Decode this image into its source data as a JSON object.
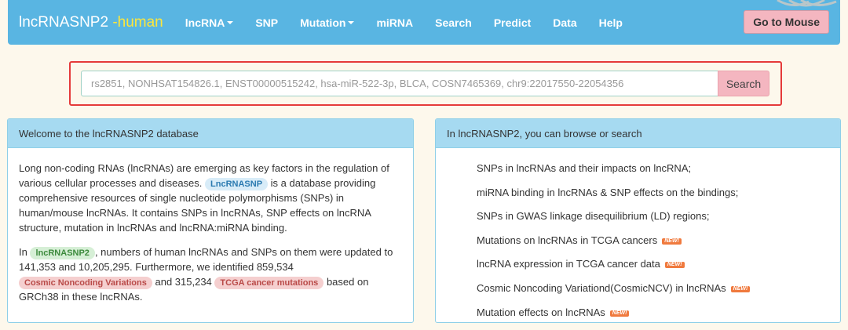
{
  "navbar": {
    "brand_main": "lncRNASNP2",
    "brand_sub": " -human",
    "items": [
      {
        "label": "lncRNA",
        "dropdown": true
      },
      {
        "label": "SNP",
        "dropdown": false
      },
      {
        "label": "Mutation",
        "dropdown": true
      },
      {
        "label": "miRNA",
        "dropdown": false
      },
      {
        "label": "Search",
        "dropdown": false
      },
      {
        "label": "Predict",
        "dropdown": false
      },
      {
        "label": "Data",
        "dropdown": false
      },
      {
        "label": "Help",
        "dropdown": false
      }
    ],
    "mouse_button": "Go to Mouse"
  },
  "search": {
    "placeholder": "rs2851, NONHSAT154826.1, ENST00000515242, hsa-miR-522-3p, BLCA, COSN7465369, chr9:22017550-22054356",
    "button": "Search"
  },
  "welcome": {
    "heading": "Welcome to the lncRNASNP2 database",
    "p1_a": "Long non-coding RNAs (lncRNAs) are emerging as key factors in the regulation of various cellular processes and diseases.",
    "p1_tag": "LncRNASNP",
    "p1_b": "is a database providing comprehensive resources of single nucleotide polymorphisms (SNPs) in human/mouse lncRNAs. It contains SNPs in lncRNAs, SNP effects on lncRNA structure, mutation in lncRNAs and lncRNA:miRNA binding.",
    "p2_a": "In",
    "p2_tag": "lncRNASNP2",
    "p2_b": ", numbers of human lncRNAs and SNPs on them were updated to 141,353 and 10,205,295. Furthermore, we identified 859,534",
    "p2_tag2": "Cosmic Noncoding Variations",
    "p2_c": "and 315,234",
    "p2_tag3": "TCGA cancer mutations",
    "p2_d": "based on GRCh38 in these lncRNAs."
  },
  "browse": {
    "heading": "In lncRNASNP2, you can browse or search",
    "new_badge": "NEW!",
    "items": [
      {
        "text": "SNPs in lncRNAs and their impacts on lncRNA;",
        "new": false
      },
      {
        "text": "miRNA binding in lncRNAs & SNP effects on the bindings;",
        "new": false
      },
      {
        "text": "SNPs in GWAS linkage disequilibrium (LD) regions;",
        "new": false
      },
      {
        "text": "Mutations on lncRNAs in TCGA cancers",
        "new": true
      },
      {
        "text": "lncRNA expression in TCGA cancer data",
        "new": true
      },
      {
        "text": "Cosmic Noncoding Variationd(CosmicNCV) in lncRNAs",
        "new": true
      },
      {
        "text": "Mutation effects on lncRNAs",
        "new": true
      }
    ]
  }
}
